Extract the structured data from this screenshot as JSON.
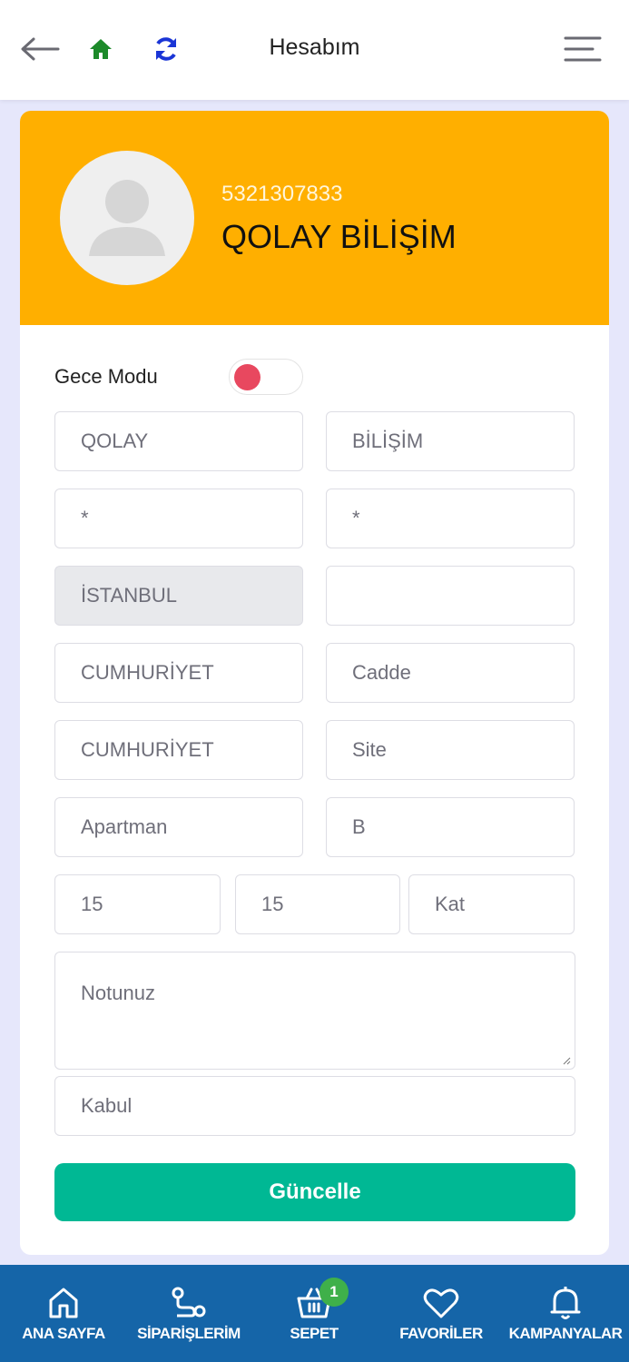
{
  "header": {
    "title": "Hesabım",
    "icons": [
      "back-arrow-icon",
      "home-icon",
      "sync-icon",
      "menu-icon"
    ],
    "colors": {
      "home": "#1d8a2a",
      "sync": "#1a35d6"
    }
  },
  "profile": {
    "phone": "5321307833",
    "name": "QOLAY BİLİŞİM",
    "header_color": "#ffaf00"
  },
  "settings": {
    "night_mode_label": "Gece Modu",
    "night_mode_on": false
  },
  "form": {
    "first_name": "QOLAY",
    "last_name": "BİLİŞİM",
    "field_3": "*",
    "field_4": "*",
    "city": "İSTANBUL",
    "district": "",
    "neighborhood": "CUMHURİYET",
    "street_placeholder": "Cadde",
    "avenue": "CUMHURİYET",
    "site_placeholder": "Site",
    "apartment_placeholder": "Apartman",
    "block": "B",
    "door_no": "15",
    "number": "15",
    "floor_placeholder": "Kat",
    "notes_placeholder": "Notunuz",
    "accept_placeholder": "Kabul",
    "submit_label": "Güncelle",
    "submit_color": "#00b894"
  },
  "bottom_nav": {
    "items": [
      {
        "label": "ANA SAYFA",
        "icon": "home-outline-icon"
      },
      {
        "label": "SİPARİŞLERİM",
        "icon": "route-icon"
      },
      {
        "label": "SEPET",
        "icon": "basket-icon",
        "badge": "1"
      },
      {
        "label": "FAVORİLER",
        "icon": "heart-icon"
      },
      {
        "label": "KAMPANYALAR",
        "icon": "bell-icon"
      }
    ],
    "background": "#1565a8"
  }
}
